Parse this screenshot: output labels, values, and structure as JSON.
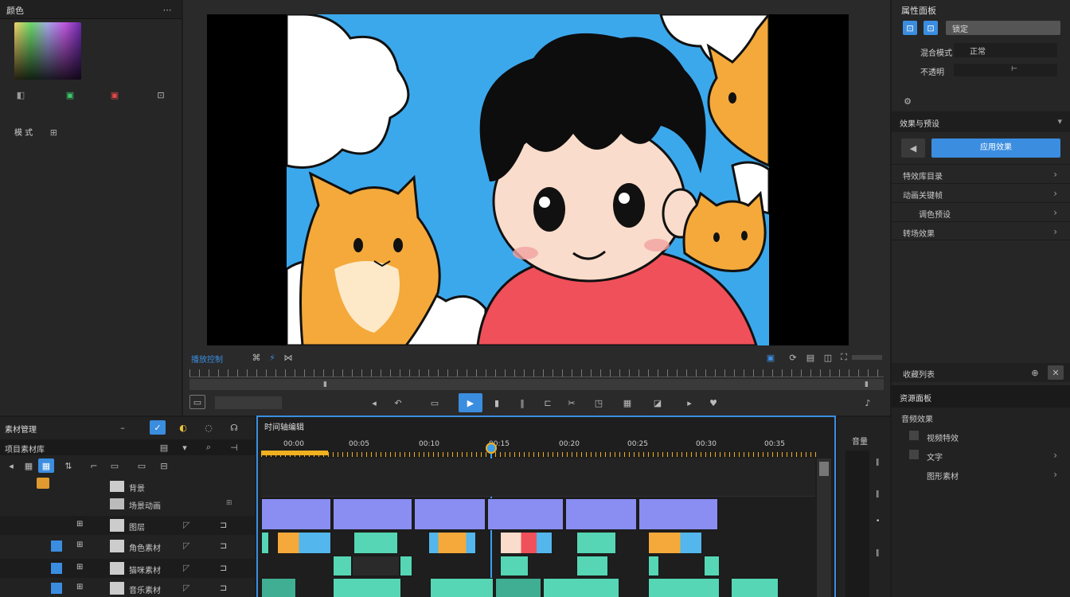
{
  "colors": {
    "accent": "#3b8de0",
    "timeline_marker": "#f0b020",
    "audio_clip": "#8a8ef2",
    "video_clip": "#56d6b4",
    "playhead": "#3aa0f0"
  },
  "left_panel": {
    "title": "颜色",
    "swatch_icons": [
      "eyedropper-icon",
      "add-icon",
      "remove-icon",
      "grid-icon"
    ],
    "mode_label": "模 式"
  },
  "viewer": {
    "left_label": "播放控制",
    "right_controls": [
      "fit-icon",
      "loop-icon",
      "layout-icon",
      "split-icon"
    ],
    "transport": [
      "prev-icon",
      "undo-icon",
      "record-icon",
      "play-icon",
      "pause-icon",
      "stop-icon",
      "marker-icon",
      "grid-icon",
      "next-icon",
      "heart-icon"
    ]
  },
  "inspector": {
    "title": "属性面板",
    "lock_label": "锁定",
    "blend_label": "混合模式",
    "blend_value": "正常",
    "opacity_label": "不透明",
    "settings_icon": "gear-icon",
    "section_title": "效果与预设",
    "apply_button": "应用效果",
    "items": [
      "特效库目录",
      "动画关键帧",
      "调色预设",
      "转场效果"
    ],
    "footer_label": "收藏列表"
  },
  "media_panel": {
    "title": "素材管理",
    "tab_label": "项目素材库",
    "tree": [
      {
        "name": "背景"
      },
      {
        "name": "场景动画"
      },
      {
        "name": "图层"
      },
      {
        "name": "角色素材"
      },
      {
        "name": "猫咪素材"
      },
      {
        "name": "音乐素材"
      }
    ]
  },
  "timeline": {
    "title": "时间轴编辑",
    "ticks": [
      "00:00",
      "00:05",
      "00:10",
      "00:15",
      "00:20",
      "00:25",
      "00:30",
      "00:35"
    ],
    "right_label": "音量"
  },
  "effects_panel": {
    "title": "资源面板",
    "items": [
      "音频效果",
      "视频特效",
      "文字",
      "图形素材"
    ]
  }
}
